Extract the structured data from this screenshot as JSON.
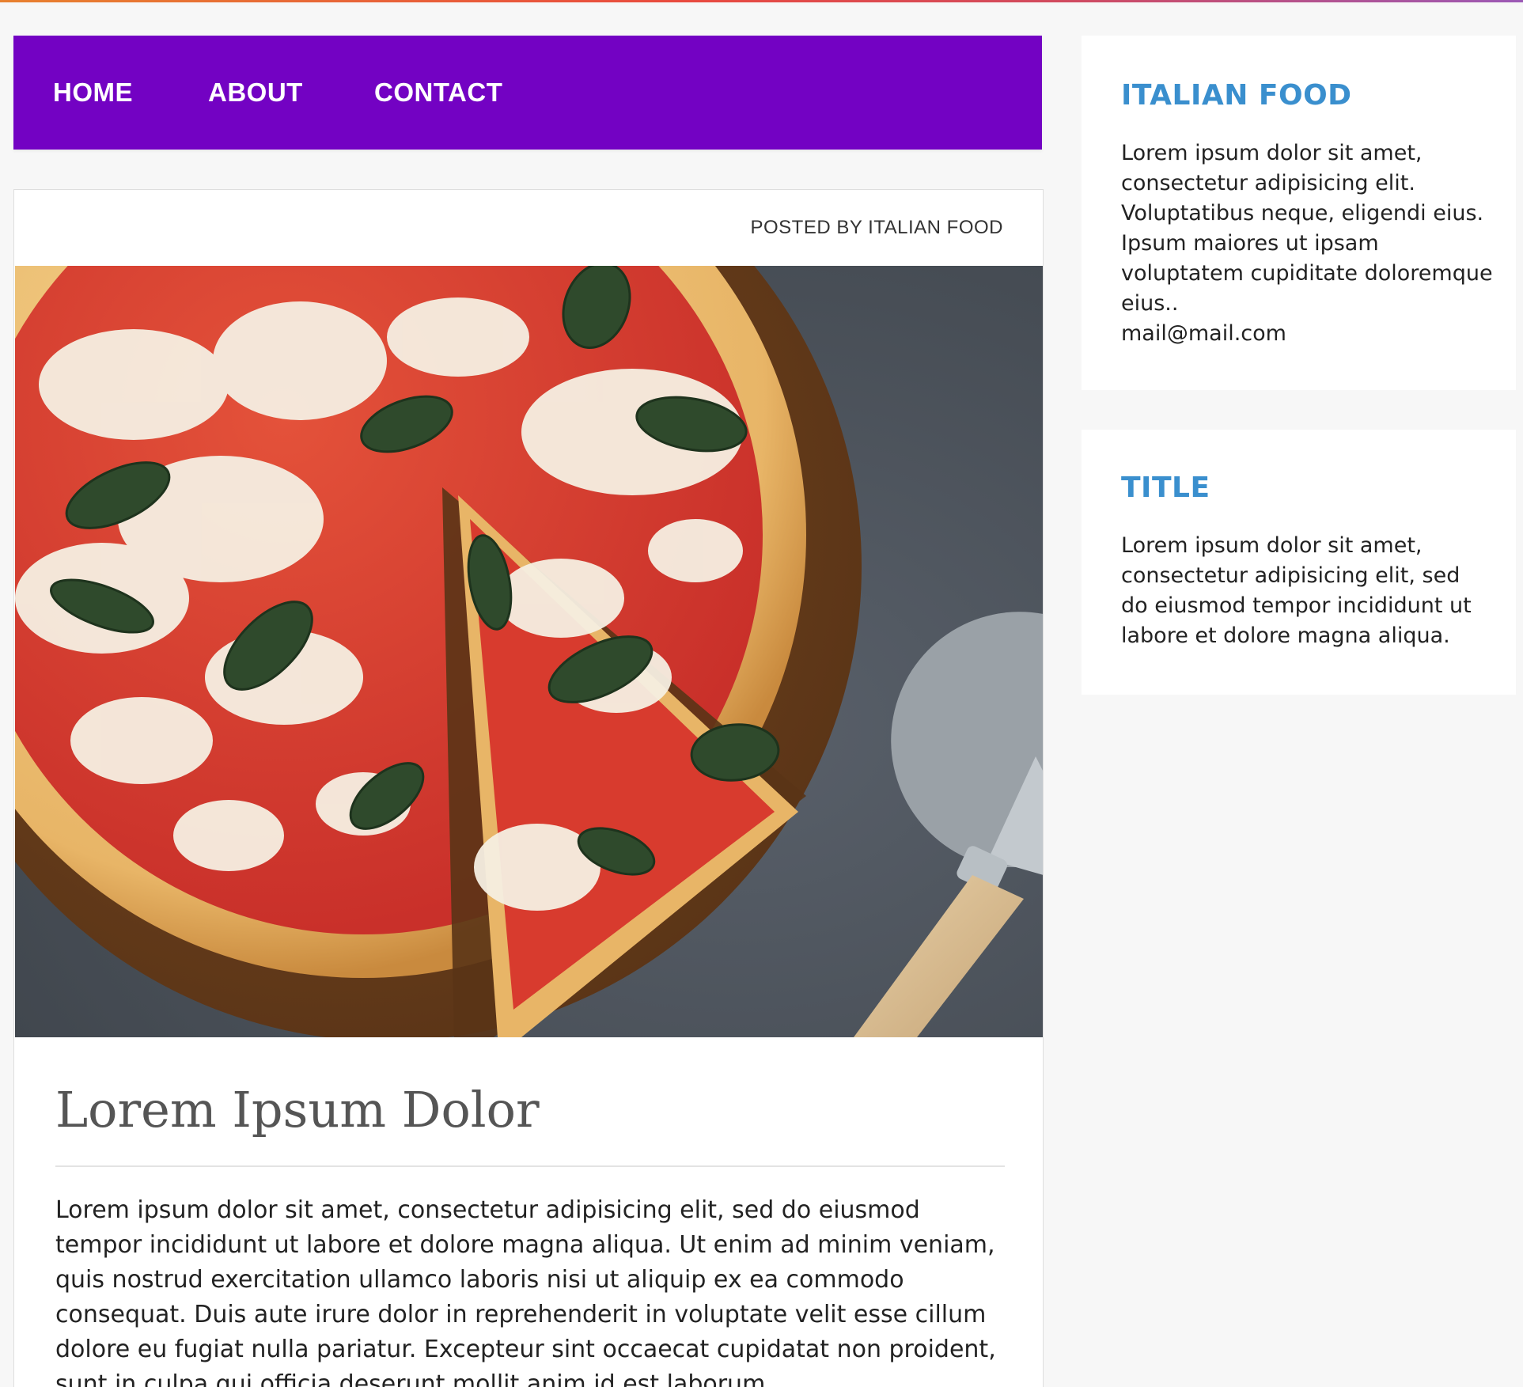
{
  "nav": {
    "items": [
      {
        "label": "HOME"
      },
      {
        "label": "ABOUT"
      },
      {
        "label": "CONTACT"
      }
    ]
  },
  "post": {
    "posted_by": "POSTED BY ITALIAN FOOD",
    "title": "Lorem Ipsum Dolor",
    "body": "Lorem ipsum dolor sit amet, consectetur adipisicing elit, sed do eiusmod tempor incididunt ut labore et dolore magna aliqua. Ut enim ad minim veniam, quis nostrud exercitation ullamco laboris nisi ut aliquip ex ea commodo consequat. Duis aute irure dolor in reprehenderit in voluptate velit esse cillum dolore eu fugiat nulla pariatur. Excepteur sint occaecat cupidatat non proident, sunt in culpa qui officia deserunt mollit anim id est laborum."
  },
  "sidebar": {
    "widgets": [
      {
        "title": "ITALIAN FOOD",
        "text": "Lorem ipsum dolor sit amet, consectetur adipisicing elit. Voluptatibus neque, eligendi eius. Ipsum maiores ut ipsam voluptatem cupiditate doloremque eius..",
        "email": "mail@mail.com"
      },
      {
        "title": "TITLE",
        "text": "Lorem ipsum dolor sit amet, consectetur adipisicing elit, sed do eiusmod tempor incididunt ut labore et dolore magna aliqua."
      }
    ]
  },
  "colors": {
    "nav_background": "#7302c3",
    "widget_title": "#3a8fce",
    "page_background": "#f7f7f7"
  }
}
